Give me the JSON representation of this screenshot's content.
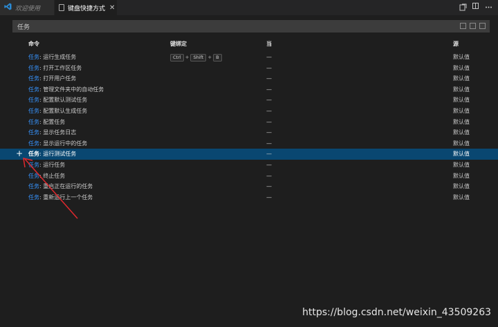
{
  "tabs": [
    {
      "label": "欢迎使用",
      "icon": "vscode-icon",
      "active": false
    },
    {
      "label": "键盘快捷方式",
      "icon": "file-icon",
      "active": true,
      "close": "✕"
    }
  ],
  "search": {
    "value": "任务"
  },
  "columns": {
    "command": "命令",
    "keybinding": "键绑定",
    "when": "当",
    "source": "源"
  },
  "rows": [
    {
      "category": "任务",
      "sep": ": ",
      "name": "运行生成任务",
      "keys": [
        "Ctrl",
        "Shift",
        "B"
      ],
      "when": "—",
      "source": "默认值"
    },
    {
      "category": "任务",
      "sep": ": ",
      "name": "打开工作区任务",
      "keys": [],
      "when": "—",
      "source": "默认值"
    },
    {
      "category": "任务",
      "sep": ": ",
      "name": "打开用户任务",
      "keys": [],
      "when": "—",
      "source": "默认值"
    },
    {
      "category": "任务",
      "sep": ": ",
      "name": "管理文件夹中的自动任务",
      "keys": [],
      "when": "—",
      "source": "默认值"
    },
    {
      "category": "任务",
      "sep": ": ",
      "name": "配置默认测试任务",
      "keys": [],
      "when": "—",
      "source": "默认值"
    },
    {
      "category": "任务",
      "sep": ": ",
      "name": "配置默认生成任务",
      "keys": [],
      "when": "—",
      "source": "默认值"
    },
    {
      "category": "任务",
      "sep": ": ",
      "name": "配置任务",
      "keys": [],
      "when": "—",
      "source": "默认值"
    },
    {
      "category": "任务",
      "sep": ": ",
      "name": "显示任务日志",
      "keys": [],
      "when": "—",
      "source": "默认值"
    },
    {
      "category": "任务",
      "sep": ": ",
      "name": "显示运行中的任务",
      "keys": [],
      "when": "—",
      "source": "默认值"
    },
    {
      "category": "任务",
      "sep": ": ",
      "name": "运行测试任务",
      "keys": [],
      "when": "—",
      "source": "默认值",
      "selected": true
    },
    {
      "category": "任务",
      "sep": ": ",
      "name": "运行任务",
      "keys": [],
      "when": "—",
      "source": "默认值"
    },
    {
      "category": "任务",
      "sep": ": ",
      "name": "终止任务",
      "keys": [],
      "when": "—",
      "source": "默认值"
    },
    {
      "category": "任务",
      "sep": ": ",
      "name": "重启正在运行的任务",
      "keys": [],
      "when": "—",
      "source": "默认值"
    },
    {
      "category": "任务",
      "sep": ": ",
      "name": "重新运行上一个任务",
      "keys": [],
      "when": "—",
      "source": "默认值"
    }
  ],
  "add_button": "+",
  "watermark": "https://blog.csdn.net/weixin_43509263",
  "colors": {
    "accent": "#3794ff",
    "selection": "#094771",
    "arrow": "#e0282d"
  }
}
